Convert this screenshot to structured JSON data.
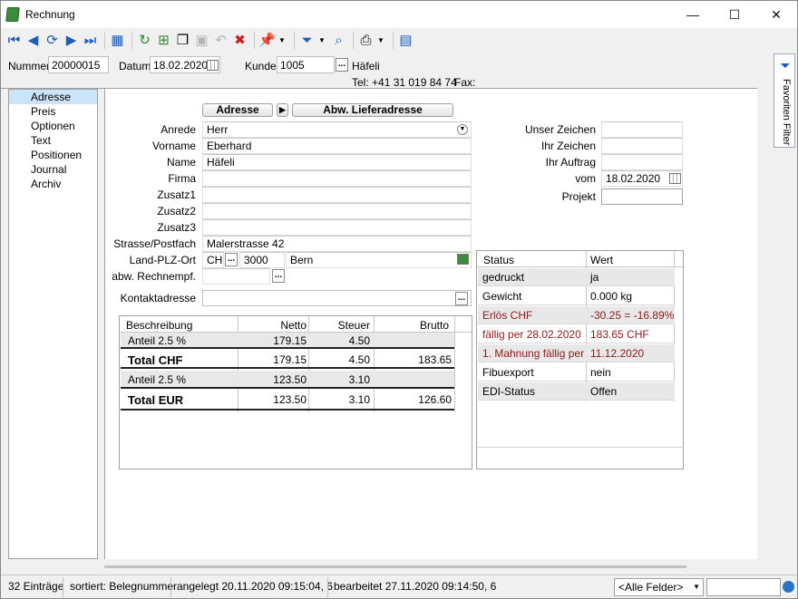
{
  "window": {
    "title": "Rechnung",
    "controls": {
      "minimize": "—",
      "maximize": "☐",
      "close": "✕"
    }
  },
  "toolbar": {
    "icons": [
      "first-record-icon",
      "prev-record-icon",
      "refresh-circle-icon",
      "next-record-icon",
      "last-record-icon",
      "table-icon",
      "reload-icon",
      "new-record-icon",
      "copy-record-icon",
      "save-icon",
      "undo-icon",
      "delete-icon",
      "pin-icon",
      "filter-icon",
      "find-icon",
      "print-icon",
      "export-icon"
    ]
  },
  "header": {
    "nummer_label": "Nummer",
    "nummer_value": "20000015",
    "datum_label": "Datum",
    "datum_value": "18.02.2020",
    "kunde_label": "Kunde",
    "kunde_value": "1005",
    "kunde_btn": "...",
    "kunde_name": "Häfeli",
    "tel": "Tel: +41 31 019 84 74",
    "fax": "Fax:"
  },
  "nav": {
    "items": [
      "Adresse",
      "Preis",
      "Optionen",
      "Text",
      "Positionen",
      "Journal",
      "Archiv"
    ],
    "active": "Adresse"
  },
  "tabs": {
    "adresse": "Adresse",
    "arrow": "▶",
    "abw": "Abw. Lieferadresse"
  },
  "address": {
    "anrede_label": "Anrede",
    "anrede_value": "Herr",
    "vorname_label": "Vorname",
    "vorname_value": "Eberhard",
    "name_label": "Name",
    "name_value": "Häfeli",
    "firma_label": "Firma",
    "firma_value": "",
    "zusatz1_label": "Zusatz1",
    "zusatz2_label": "Zusatz2",
    "zusatz3_label": "Zusatz3",
    "strasse_label": "Strasse/Postfach",
    "strasse_value": "Malerstrasse 42",
    "landplz_label": "Land-PLZ-Ort",
    "land_value": "CH",
    "land_btn": "...",
    "plz_value": "3000",
    "ort_value": "Bern",
    "abw_label": "abw. Rechnempf.",
    "abw_btn": "...",
    "kontakt_label": "Kontaktadresse",
    "kontakt_btn": "..."
  },
  "right_fields": {
    "unser_zeichen": "Unser Zeichen",
    "ihr_zeichen": "Ihr Zeichen",
    "ihr_auftrag": "Ihr Auftrag",
    "vom_label": "vom",
    "vom_value": "18.02.2020",
    "projekt_label": "Projekt"
  },
  "totals": {
    "headers": [
      "Beschreibung",
      "Netto",
      "Steuer",
      "Brutto"
    ],
    "rows": [
      {
        "desc": "Anteil 2.5 %",
        "netto": "179.15",
        "steuer": "4.50",
        "brutto": ""
      },
      {
        "desc": "Total CHF",
        "netto": "179.15",
        "steuer": "4.50",
        "brutto": "183.65"
      },
      {
        "desc": "Anteil 2.5 %",
        "netto": "123.50",
        "steuer": "3.10",
        "brutto": ""
      },
      {
        "desc": "Total EUR",
        "netto": "123.50",
        "steuer": "3.10",
        "brutto": "126.60"
      }
    ]
  },
  "status_table": {
    "headers": [
      "Status",
      "Wert"
    ],
    "rows": [
      {
        "status": "gedruckt",
        "wert": "ja"
      },
      {
        "status": "Gewicht",
        "wert": "0.000 kg"
      },
      {
        "status": "Erlös CHF",
        "wert": "-30.25 = -16.89%"
      },
      {
        "status": "fällig per 28.02.2020",
        "wert": "183.65 CHF"
      },
      {
        "status": "1. Mahnung fällig per",
        "wert": "11.12.2020"
      },
      {
        "status": "Fibuexport",
        "wert": "nein"
      },
      {
        "status": "EDI-Status",
        "wert": "Offen"
      }
    ]
  },
  "side_panel": {
    "label": "Favoriten Filter"
  },
  "statusbar": {
    "count": "32 Einträge",
    "sort": "sortiert: Belegnummer",
    "created": "angelegt 20.11.2020 09:15:04,  6",
    "edited": "bearbeitet 27.11.2020 09:14:50,  6",
    "field_select": "<Alle Felder>"
  },
  "colors": {
    "accent": "#1d5bbf",
    "nav_active": "#cce4f7",
    "warning_text": "#8b1a1a",
    "row_shade": "#e8e8e8"
  }
}
